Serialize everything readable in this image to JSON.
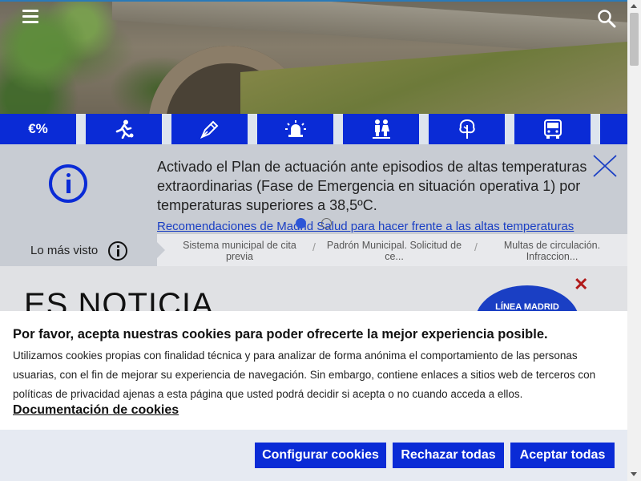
{
  "colors": {
    "brand_blue": "#0a2bd6",
    "link_blue": "#1a3fc4",
    "alert_bg": "#c8ccd3",
    "close_red": "#b11a1a"
  },
  "header": {
    "menu_icon": "hamburger-menu-icon",
    "search_icon": "search-icon"
  },
  "categories": [
    {
      "icon": "currency-percent-icon",
      "label": "€%"
    },
    {
      "icon": "sports-running-icon"
    },
    {
      "icon": "pen-nib-icon"
    },
    {
      "icon": "siren-alarm-icon"
    },
    {
      "icon": "family-people-icon"
    },
    {
      "icon": "tree-icon"
    },
    {
      "icon": "bus-icon"
    },
    {
      "icon": "more-icon"
    }
  ],
  "alert": {
    "text": "Activado el Plan de actuación ante episodios de altas temperaturas extraordinarias (Fase de Emergencia en situación operativa 1) por temperaturas superiores a 38,5ºC.",
    "link": "Recomendaciones de Madrid Salud para hacer frente a las altas temperaturas"
  },
  "most_viewed": {
    "label": "Lo más visto",
    "items": [
      {
        "line1": "Sistema municipal de cita",
        "line2": "previa"
      },
      {
        "line1": "Padrón Municipal. Solicitud de",
        "line2": "ce..."
      },
      {
        "line1": "Multas de circulación.",
        "line2": "Infraccion..."
      }
    ]
  },
  "news": {
    "title": "ES NOTICIA",
    "close": "✕",
    "badge": "LÍNEA MADRID"
  },
  "cookie": {
    "title": "Por favor, acepta nuestras cookies para poder ofrecerte la mejor experiencia posible.",
    "body": "Utilizamos cookies propias con finalidad técnica y para analizar de forma anónima el comportamiento de las personas usuarias, con el fin de mejorar su experiencia de navegación. Sin embargo, contiene enlaces a sitios web de terceros con políticas de privacidad ajenas a esta página que usted podrá decidir si acepta o no cuando acceda a ellos.",
    "doc_link": "Documentación de cookies",
    "buttons": {
      "configure": "Configurar cookies",
      "reject": "Rechazar todas",
      "accept": "Aceptar todas"
    }
  }
}
